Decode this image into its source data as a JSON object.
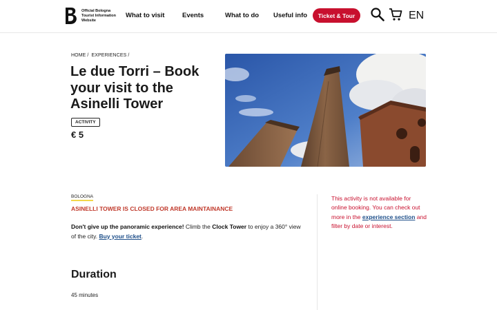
{
  "header": {
    "logo_letter": "B",
    "logo_text": [
      "Official Bologna",
      "Tourist Information",
      "Website"
    ],
    "nav": [
      "What to visit",
      "Events",
      "What to do",
      "Useful info"
    ],
    "cta": "Ticket & Tour",
    "lang": "EN"
  },
  "breadcrumb": [
    "HOME",
    "/",
    "EXPERIENCES",
    "/"
  ],
  "hero": {
    "title": "Le due Torri – Book your visit to the Asinelli Tower",
    "badge": "ACTIVITY",
    "price": "€ 5"
  },
  "content": {
    "city": "BOLOGNA",
    "closed_notice": "ASINELLI TOWER IS CLOSED FOR AREA MAINTAINANCE",
    "para_bold": "Don't give up the panoramic experience!",
    "para_1": " Climb the ",
    "para_bold2": "Clock Tower",
    "para_2": " to enjoy a 360° view of the city. ",
    "para_link": "Buy your ticket",
    "para_end": ".",
    "duration_heading": "Duration",
    "duration_value": "45 minutes"
  },
  "aside": {
    "text_1": "This activity is not available for online booking. You can check out more in the ",
    "link": "experience section",
    "text_2": " and filter by date or interest."
  },
  "colors": {
    "accent": "#c8102e",
    "link": "#1d4e89",
    "highlight": "#f3d64a"
  },
  "icons": [
    "search-icon",
    "cart-icon"
  ]
}
